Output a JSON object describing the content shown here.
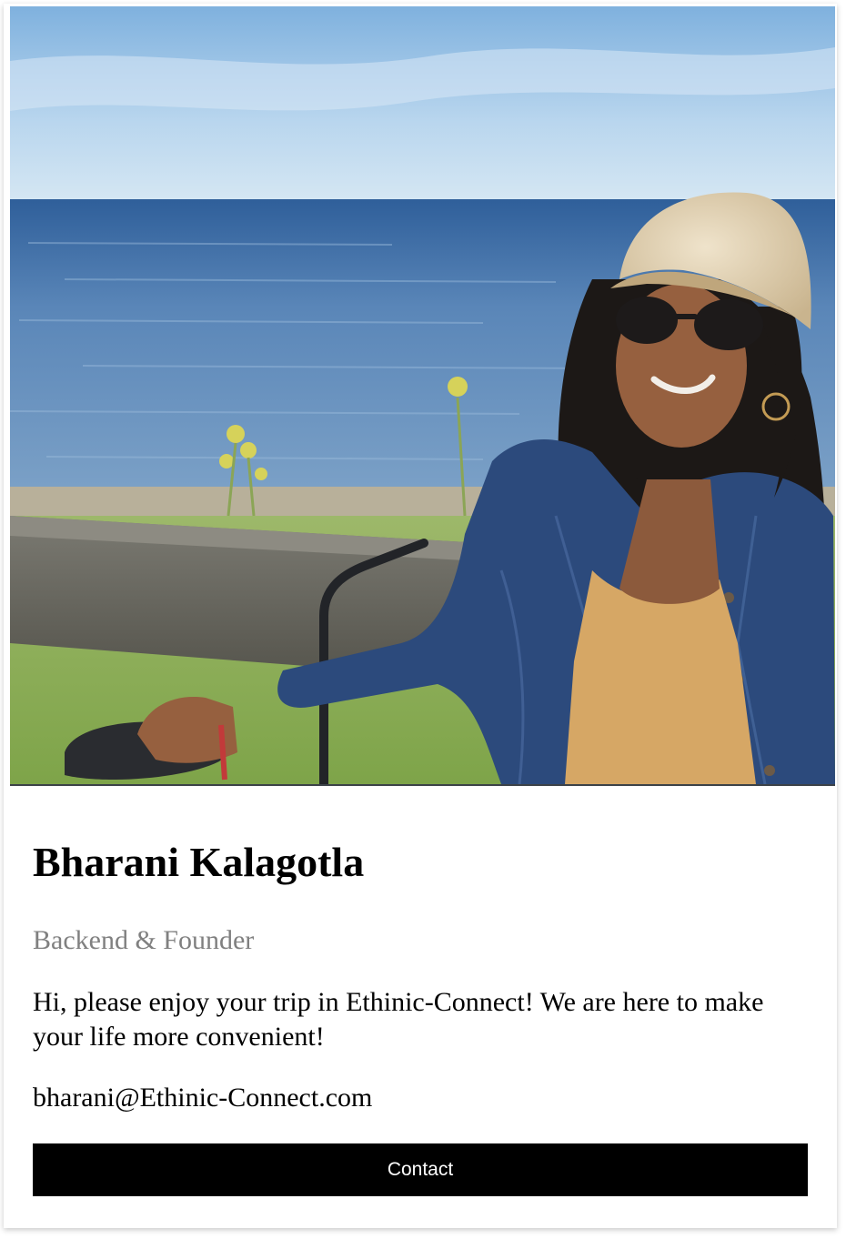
{
  "profile": {
    "photo_alt": "Bharani Kalagotla",
    "name": "Bharani Kalagotla",
    "role": "Backend & Founder",
    "bio": "Hi, please enjoy your trip in Ethinic-Connect! We are here to make your life more convenient!",
    "email": "bharani@Ethinic-Connect.com",
    "contact_label": "Contact"
  },
  "colors": {
    "button_bg": "#000000",
    "button_text": "#ffffff",
    "role_text": "#808080"
  }
}
